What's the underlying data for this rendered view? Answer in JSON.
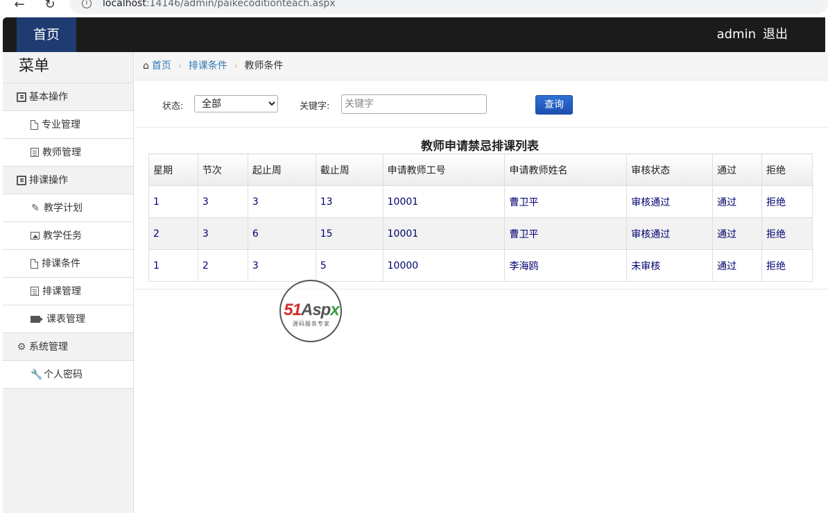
{
  "browser": {
    "url_host": "localhost",
    "url_path": ":14146/admin/paikecoditionteach.aspx"
  },
  "header": {
    "home": "首页",
    "user": "admin",
    "logout": "退出"
  },
  "sidebar": {
    "title": "菜单",
    "groups": [
      {
        "label": "基本操作",
        "items": [
          {
            "label": "专业管理"
          },
          {
            "label": "教师管理"
          }
        ]
      },
      {
        "label": "排课操作",
        "items": [
          {
            "label": "教学计划"
          },
          {
            "label": "教学任务"
          },
          {
            "label": "排课条件"
          },
          {
            "label": "排课管理"
          },
          {
            "label": "课表管理"
          }
        ]
      },
      {
        "label": "系统管理",
        "items": [
          {
            "label": "个人密码"
          }
        ]
      }
    ]
  },
  "breadcrumb": {
    "home": "首页",
    "parent": "排课条件",
    "current": "教师条件"
  },
  "filter": {
    "status_label": "状态:",
    "status_selected": "全部",
    "keyword_label": "关键字:",
    "keyword_placeholder": "关键字",
    "keyword_value": "",
    "search_button": "查询"
  },
  "table": {
    "title": "教师申请禁忌排课列表",
    "headers": [
      "星期",
      "节次",
      "起止周",
      "截止周",
      "申请教师工号",
      "申请教师姓名",
      "审核状态",
      "通过",
      "拒绝"
    ],
    "rows": [
      [
        "1",
        "3",
        "3",
        "13",
        "10001",
        "曹卫平",
        "审核通过",
        "通过",
        "拒绝"
      ],
      [
        "2",
        "3",
        "6",
        "15",
        "10001",
        "曹卫平",
        "审核通过",
        "通过",
        "拒绝"
      ],
      [
        "1",
        "2",
        "3",
        "5",
        "10000",
        "李海鸥",
        "未审核",
        "通过",
        "拒绝"
      ]
    ]
  },
  "watermark": {
    "brand_51": "51",
    "brand_asp": "Asp",
    "brand_x": "x",
    "tagline": "源码服务专家"
  }
}
